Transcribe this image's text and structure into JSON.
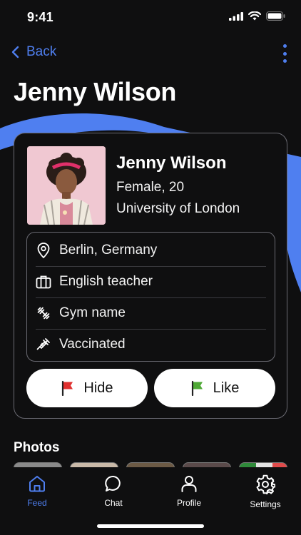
{
  "status": {
    "time": "9:41"
  },
  "nav": {
    "back_label": "Back"
  },
  "page": {
    "title": "Jenny Wilson"
  },
  "profile": {
    "name": "Jenny Wilson",
    "gender_age": "Female, 20",
    "school": "University of London"
  },
  "info": {
    "items": [
      {
        "icon": "location-pin-icon",
        "label": "Berlin, Germany"
      },
      {
        "icon": "briefcase-icon",
        "label": "English teacher"
      },
      {
        "icon": "dumbbell-icon",
        "label": "Gym name"
      },
      {
        "icon": "syringe-icon",
        "label": "Vaccinated"
      }
    ]
  },
  "actions": {
    "hide_label": "Hide",
    "like_label": "Like",
    "hide_flag_color": "#e0302f",
    "like_flag_color": "#4fa936"
  },
  "photos": {
    "title": "Photos"
  },
  "tabs": {
    "items": [
      {
        "icon": "home-icon",
        "label": "Feed",
        "active": true
      },
      {
        "icon": "chat-bubble-icon",
        "label": "Chat",
        "active": false
      },
      {
        "icon": "person-icon",
        "label": "Profile",
        "active": false
      },
      {
        "icon": "gear-icon",
        "label": "Settings",
        "active": false
      }
    ]
  },
  "colors": {
    "accent": "#4f7ff0",
    "background": "#0f0f10",
    "card_border": "#6a6a72"
  }
}
